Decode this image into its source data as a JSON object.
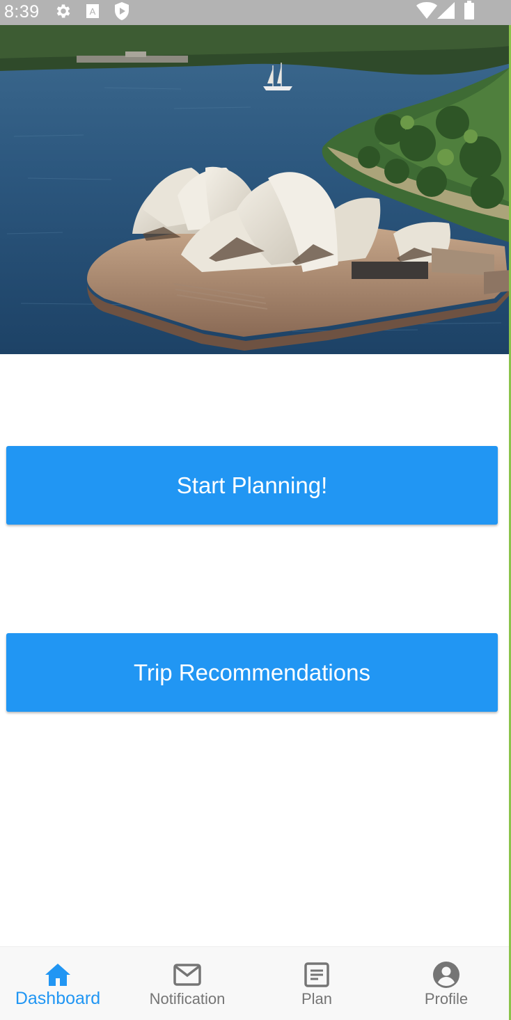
{
  "status_bar": {
    "time": "8:39",
    "icons": [
      "gear-icon",
      "font-icon",
      "shield-play-icon",
      "wifi-icon",
      "signal-icon",
      "battery-icon"
    ]
  },
  "hero": {
    "image": "sydney-opera-house-harbour-photo"
  },
  "buttons": {
    "start_planning": "Start Planning!",
    "trip_recommendations": "Trip Recommendations"
  },
  "bottom_nav": {
    "active": "Dashboard",
    "items": [
      {
        "label": "Dashboard",
        "icon": "home-icon"
      },
      {
        "label": "Notification",
        "icon": "mail-icon"
      },
      {
        "label": "Plan",
        "icon": "document-icon"
      },
      {
        "label": "Profile",
        "icon": "account-circle-icon"
      }
    ]
  },
  "colors": {
    "primary": "#2196f3",
    "status_bar": "#b3b3b3",
    "nav_inactive": "#757575",
    "edge_accent": "#8bc34a"
  }
}
